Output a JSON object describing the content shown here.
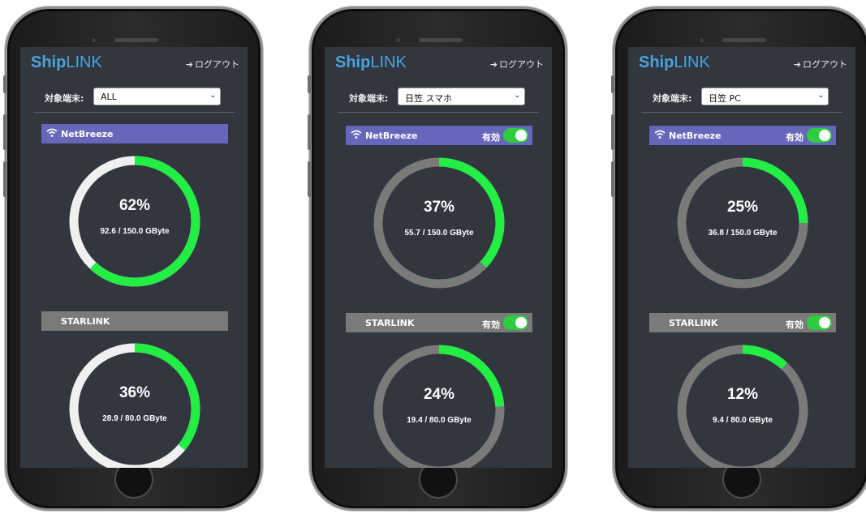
{
  "app": {
    "brand_bold": "Ship",
    "brand_light": "LINK",
    "logout_label": "ログアウト",
    "logout_icon": "sign-out-icon"
  },
  "colors": {
    "brand": "#4ba3dc",
    "used": "#22ee44",
    "ring_bg_all": "#f0f0f0",
    "ring_bg_device": "#7a7a7a",
    "netbreeze_bar": "#6666bb",
    "starlink_bar": "#7a7a7a",
    "toggle_on": "#2ecc40"
  },
  "phones": [
    {
      "selector": {
        "label": "対象端末:",
        "value": "ALL"
      },
      "networks": [
        {
          "name": "NetBreeze",
          "icon": "wifi-icon",
          "toggle": null,
          "percent": 0.62,
          "percent_label": "62%",
          "usage": "92.6 / 150.0 GByte"
        },
        {
          "name": "STARLINK",
          "icon": null,
          "toggle": null,
          "percent": 0.36,
          "percent_label": "36%",
          "usage": "28.9 / 80.0 GByte"
        }
      ]
    },
    {
      "selector": {
        "label": "対象端末:",
        "value": "日笠 スマホ"
      },
      "networks": [
        {
          "name": "NetBreeze",
          "icon": "wifi-icon",
          "toggle": {
            "label": "有効",
            "on": true
          },
          "percent": 0.37,
          "percent_label": "37%",
          "usage": "55.7 / 150.0 GByte"
        },
        {
          "name": "STARLINK",
          "icon": null,
          "toggle": {
            "label": "有効",
            "on": true
          },
          "percent": 0.24,
          "percent_label": "24%",
          "usage": "19.4 / 80.0 GByte"
        }
      ]
    },
    {
      "selector": {
        "label": "対象端末:",
        "value": "日笠 PC"
      },
      "networks": [
        {
          "name": "NetBreeze",
          "icon": "wifi-icon",
          "toggle": {
            "label": "有効",
            "on": true
          },
          "percent": 0.25,
          "percent_label": "25%",
          "usage": "36.8 / 150.0 GByte"
        },
        {
          "name": "STARLINK",
          "icon": null,
          "toggle": {
            "label": "有効",
            "on": true
          },
          "percent": 0.12,
          "percent_label": "12%",
          "usage": "9.4 / 80.0 GByte"
        }
      ]
    }
  ]
}
